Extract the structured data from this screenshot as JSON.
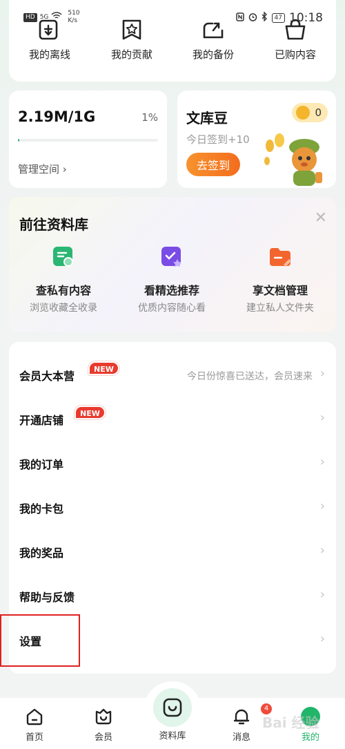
{
  "status_bar": {
    "hd": "HD",
    "signal": "5G",
    "speed_value": "510",
    "speed_unit": "K/s",
    "battery": "47",
    "time": "10:18"
  },
  "quick_actions": [
    {
      "label": "我的离线",
      "icon": "offline-download-icon"
    },
    {
      "label": "我的贡献",
      "icon": "contribution-star-icon"
    },
    {
      "label": "我的备份",
      "icon": "backup-icon"
    },
    {
      "label": "已购内容",
      "icon": "purchased-bag-icon"
    }
  ],
  "storage": {
    "amount": "2.19M/1G",
    "percent": "1%",
    "fill_fraction": 0.01,
    "manage_label": "管理空间 ›"
  },
  "coins": {
    "title": "文库豆",
    "count": "0",
    "subtitle": "今日签到+10",
    "checkin_label": "去签到"
  },
  "library_promo": {
    "title": "前往资料库",
    "close": "✕",
    "items": [
      {
        "title": "查私有内容",
        "desc": "浏览收藏全收录",
        "icon": "private-content-icon",
        "color": "#2bb673"
      },
      {
        "title": "看精选推荐",
        "desc": "优质内容随心看",
        "icon": "featured-recommend-icon",
        "color": "#7a4ce6"
      },
      {
        "title": "享文档管理",
        "desc": "建立私人文件夹",
        "icon": "document-folder-icon",
        "color": "#f2652e"
      }
    ]
  },
  "menu": [
    {
      "label": "会员大本营",
      "badge": "NEW",
      "hint": "今日份惊喜已送达，会员速来"
    },
    {
      "label": "开通店铺",
      "badge": "NEW",
      "hint": ""
    },
    {
      "label": "我的订单",
      "badge": "",
      "hint": ""
    },
    {
      "label": "我的卡包",
      "badge": "",
      "hint": ""
    },
    {
      "label": "我的奖品",
      "badge": "",
      "hint": ""
    },
    {
      "label": "帮助与反馈",
      "badge": "",
      "hint": ""
    },
    {
      "label": "设置",
      "badge": "",
      "hint": ""
    }
  ],
  "chevron": "›",
  "bottom_nav": [
    {
      "label": "首页",
      "icon": "home-icon"
    },
    {
      "label": "会员",
      "icon": "member-icon"
    },
    {
      "label": "资料库",
      "icon": "library-icon"
    },
    {
      "label": "消息",
      "icon": "bell-icon",
      "badge": "4"
    },
    {
      "label": "我的",
      "icon": "profile-avatar-icon"
    }
  ],
  "watermark": "Bai 经验",
  "colors": {
    "brand_green": "#21b56a",
    "checkin_orange": "#f36d1e",
    "new_red": "#e93a2e",
    "highlight_red": "#e02020"
  }
}
